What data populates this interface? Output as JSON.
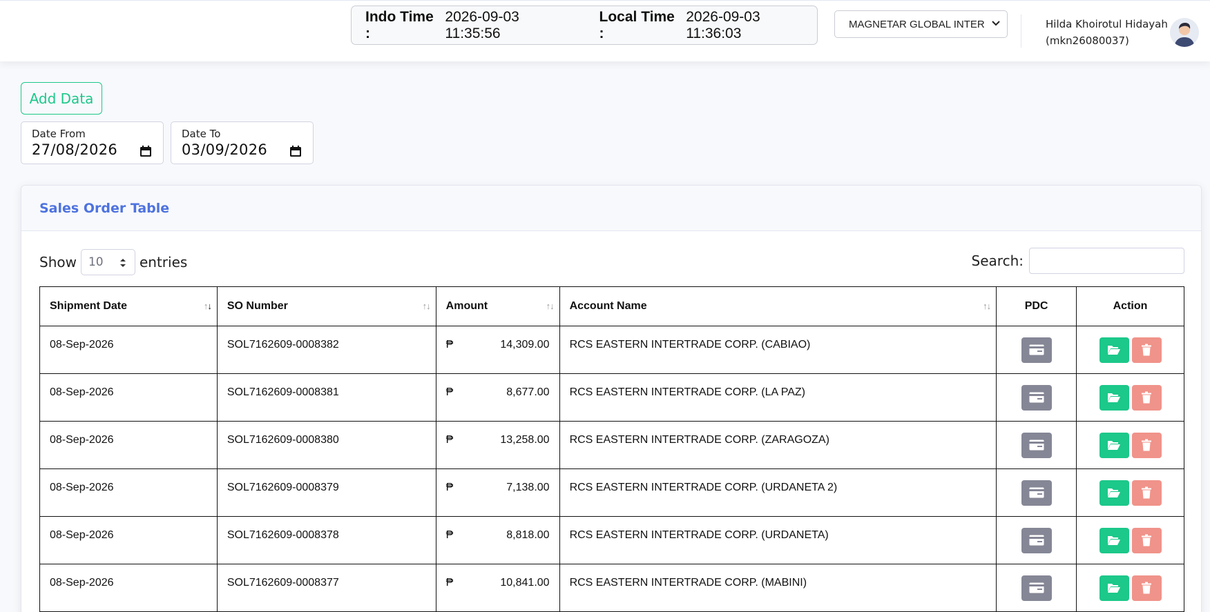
{
  "header": {
    "indo_label": "Indo Time :",
    "indo_time": "2026-09-03 11:35:56",
    "local_label": "Local Time :",
    "local_time": "2026-09-03 11:36:03",
    "company": "MAGNETAR GLOBAL INTER",
    "user_name": "Hilda Khoirotul Hidayah",
    "user_id": "(mkn26080037)"
  },
  "toolbar": {
    "add_label": "Add Data",
    "date_from_label": "Date From",
    "date_from": "27/08/2026",
    "date_to_label": "Date To",
    "date_to": "03/09/2026"
  },
  "table_card": {
    "title": "Sales Order Table",
    "show_label": "Show",
    "entries_value": "10",
    "entries_label": "entries",
    "search_label": "Search:",
    "search_value": ""
  },
  "columns": {
    "shipment_date": "Shipment Date",
    "so_number": "SO Number",
    "amount": "Amount",
    "account_name": "Account Name",
    "pdc": "PDC",
    "action": "Action"
  },
  "currency_symbol": "₱",
  "rows": [
    {
      "date": "08-Sep-2026",
      "so": "SOL7162609-0008382",
      "amount": "14,309.00",
      "account": "RCS EASTERN INTERTRADE CORP. (CABIAO)"
    },
    {
      "date": "08-Sep-2026",
      "so": "SOL7162609-0008381",
      "amount": "8,677.00",
      "account": "RCS EASTERN INTERTRADE CORP. (LA PAZ)"
    },
    {
      "date": "08-Sep-2026",
      "so": "SOL7162609-0008380",
      "amount": "13,258.00",
      "account": "RCS EASTERN INTERTRADE CORP. (ZARAGOZA)"
    },
    {
      "date": "08-Sep-2026",
      "so": "SOL7162609-0008379",
      "amount": "7,138.00",
      "account": "RCS EASTERN INTERTRADE CORP. (URDANETA 2)"
    },
    {
      "date": "08-Sep-2026",
      "so": "SOL7162609-0008378",
      "amount": "8,818.00",
      "account": "RCS EASTERN INTERTRADE CORP. (URDANETA)"
    },
    {
      "date": "08-Sep-2026",
      "so": "SOL7162609-0008377",
      "amount": "10,841.00",
      "account": "RCS EASTERN INTERTRADE CORP. (MABINI)"
    }
  ],
  "colors": {
    "primary": "#4e73df",
    "success": "#1cc88a",
    "secondary": "#858796",
    "danger_light": "#f0938a"
  },
  "icons": {
    "pdc": "credit-card-icon",
    "open": "folder-open-icon",
    "delete": "trash-icon",
    "calendar": "calendar-icon",
    "select": "chevron-down-icon",
    "sort": "sort-icon"
  }
}
